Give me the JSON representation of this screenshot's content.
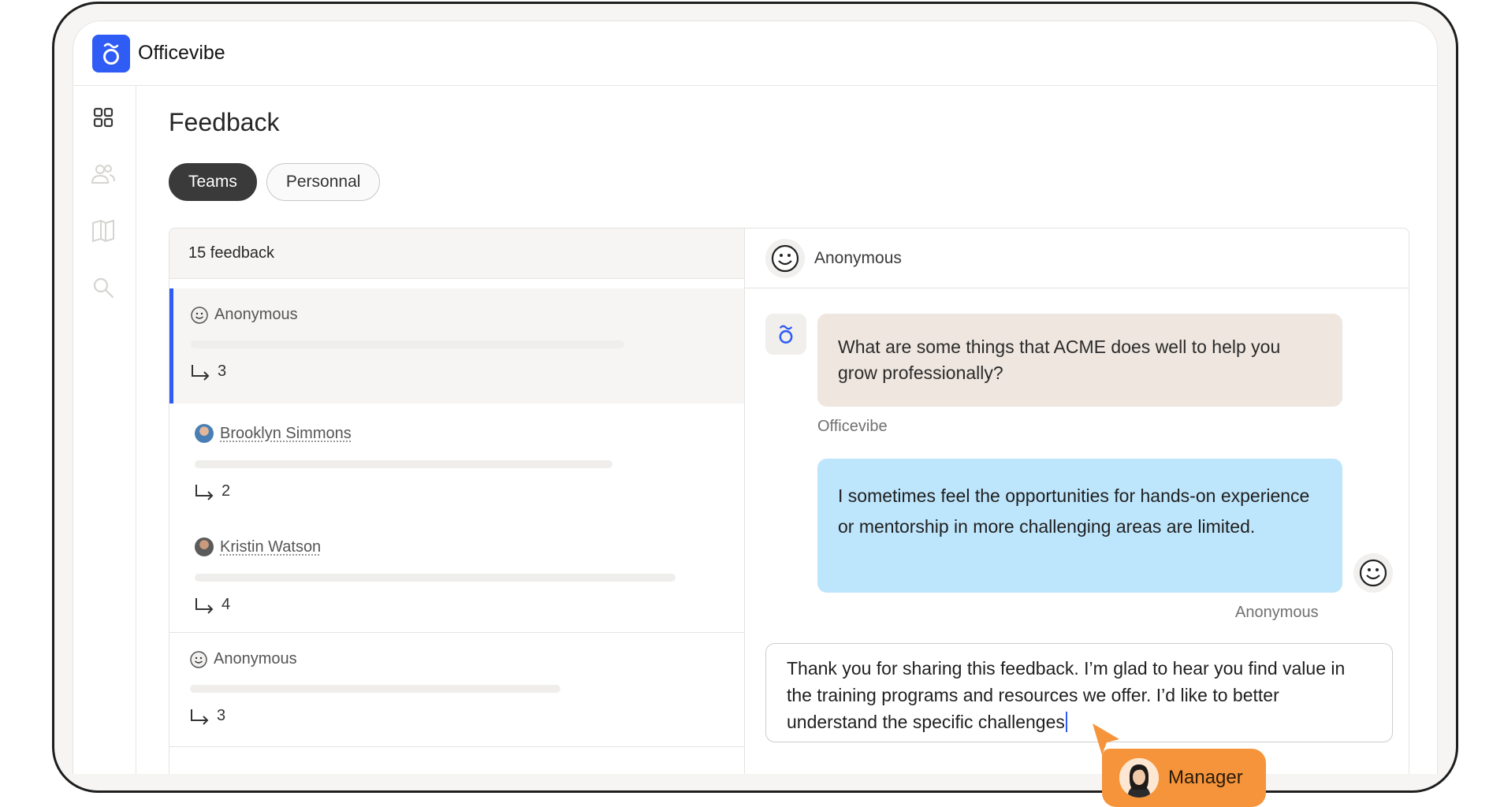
{
  "app": {
    "brand": "Officevibe"
  },
  "sidebar": {
    "items": [
      {
        "icon": "grid-icon",
        "active": true
      },
      {
        "icon": "people-icon",
        "active": false
      },
      {
        "icon": "book-icon",
        "active": false
      },
      {
        "icon": "search-icon",
        "active": false
      }
    ]
  },
  "page": {
    "title": "Feedback"
  },
  "tabs": [
    {
      "label": "Teams",
      "active": true
    },
    {
      "label": "Personnal",
      "active": false
    }
  ],
  "list": {
    "header": "15 feedback",
    "items": [
      {
        "name": "Anonymous",
        "type": "anonymous",
        "count": "3",
        "selected": true
      },
      {
        "name": "Brooklyn Simmons",
        "type": "person",
        "count": "2",
        "selected": false
      },
      {
        "name": "Kristin Watson",
        "type": "person",
        "count": "4",
        "selected": false
      },
      {
        "name": "Anonymous",
        "type": "anonymous",
        "count": "3",
        "selected": false
      }
    ]
  },
  "conversation": {
    "header_name": "Anonymous",
    "question": {
      "text": "What are some things that ACME does well to help you grow professionally?",
      "author": "Officevibe"
    },
    "answer": {
      "text": "I sometimes feel the opportunities for hands-on experience or mentorship in more challenging areas are limited.",
      "author": "Anonymous"
    },
    "composer_text": "Thank you for sharing this feedback. I’m glad to hear you find value in the training programs and resources we offer. I’d like to better understand the specific challenges"
  },
  "cursor_tag": {
    "label": "Manager"
  },
  "colors": {
    "accent": "#2f5cf5",
    "question_bubble": "#eee6df",
    "answer_bubble": "#bde5fb",
    "manager_tag": "#f5943a"
  }
}
